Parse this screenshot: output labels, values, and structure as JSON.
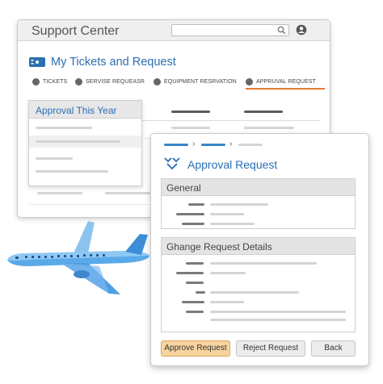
{
  "app": {
    "title": "Support Center"
  },
  "search": {
    "placeholder": ""
  },
  "page": {
    "title": "My Tickets and Request"
  },
  "tabs": [
    {
      "label": "TICKETS",
      "active": false
    },
    {
      "label": "SERVISE REQUEASR",
      "active": false
    },
    {
      "label": "EQUIPMENT RESRVATION",
      "active": false
    },
    {
      "label": "APPRUVAL REQUEST",
      "active": true
    }
  ],
  "dropdown": {
    "title": "Approval This Year"
  },
  "dialog": {
    "title": "Approval Request",
    "sections": [
      {
        "title": "General"
      },
      {
        "title": "Ghange Request Details"
      }
    ],
    "buttons": {
      "approve": "Approve Request",
      "reject": "Reject Request",
      "back": "Back"
    }
  },
  "colors": {
    "accent": "#2a6fb3",
    "active_tab_underline": "#e57c32",
    "primary_button": "#f7d39e"
  },
  "icons": {
    "search": "search-icon",
    "user": "user-icon",
    "tickets": "ticket-icon",
    "approval": "approval-icon",
    "plane": "airplane-illustration"
  }
}
